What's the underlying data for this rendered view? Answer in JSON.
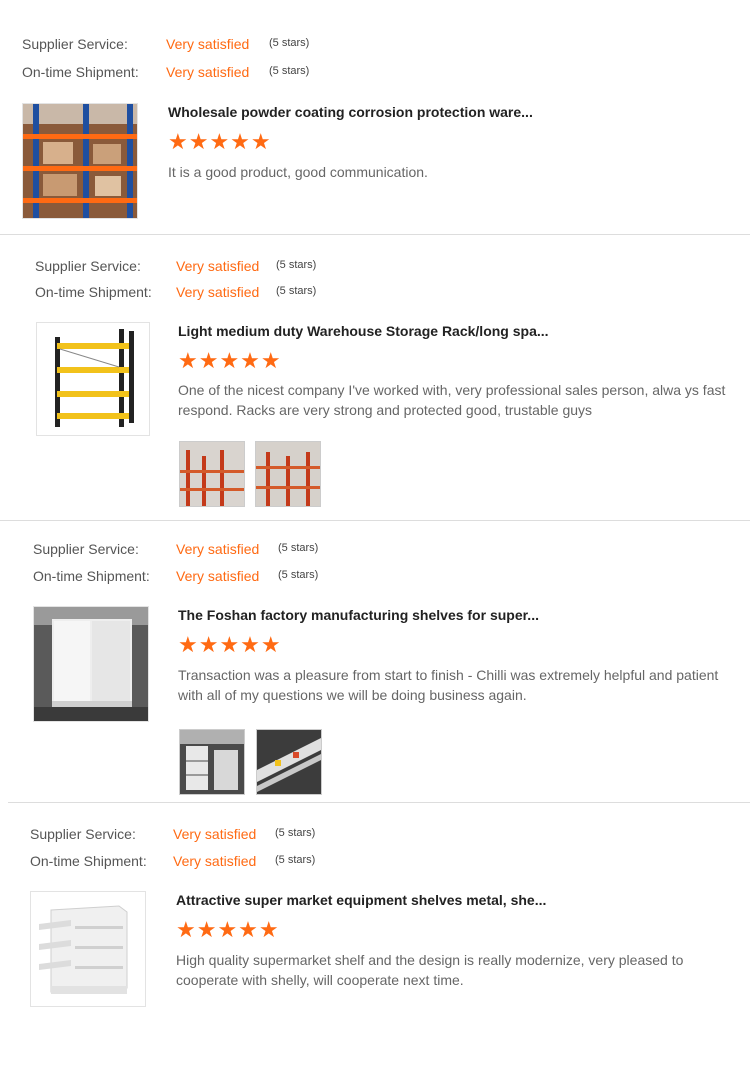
{
  "colors": {
    "accent": "#ff6a13",
    "text": "#333333",
    "muted": "#666666",
    "divider": "#dddddd"
  },
  "reviews": [
    {
      "supplier_label": "Supplier Service:",
      "supplier_value": "Very satisfied",
      "supplier_count": "(5 stars)",
      "shipment_label": "On-time Shipment:",
      "shipment_value": "Very satisfied",
      "shipment_count": "(5 stars)",
      "title": "Wholesale powder coating corrosion protection ware...",
      "rating": 5,
      "stars": "★★★★★",
      "text": "It is a good product, good communication."
    },
    {
      "supplier_label": "Supplier Service:",
      "supplier_value": "Very satisfied",
      "supplier_count": "(5 stars)",
      "shipment_label": "On-time Shipment:",
      "shipment_value": "Very satisfied",
      "shipment_count": "(5 stars)",
      "title": "Light medium duty Warehouse Storage Rack/long spa...",
      "rating": 5,
      "stars": "★★★★★",
      "text": "One of the nicest company I've worked with, very  professional sales person, alwa ys fast respond. Racks are very strong and protected good, trustable guys"
    },
    {
      "supplier_label": "Supplier Service:",
      "supplier_value": "Very satisfied",
      "supplier_count": "(5 stars)",
      "shipment_label": "On-time Shipment:",
      "shipment_value": "Very satisfied",
      "shipment_count": "(5 stars)",
      "title": "The Foshan factory manufacturing shelves for super...",
      "rating": 5,
      "stars": "★★★★★",
      "text": "Transaction was a pleasure from start to finish - Chilli was extremely helpful and patient with all of my questions we will be doing business again."
    },
    {
      "supplier_label": "Supplier Service:",
      "supplier_value": "Very satisfied",
      "supplier_count": "(5 stars)",
      "shipment_label": "On-time Shipment:",
      "shipment_value": "Very satisfied",
      "shipment_count": "(5 stars)",
      "title": "Attractive super market equipment shelves metal, she...",
      "rating": 5,
      "stars": "★★★★★",
      "text": "High quality supermarket shelf and the design is really modernize, very pleased to cooperate with shelly, will cooperate next time."
    }
  ]
}
